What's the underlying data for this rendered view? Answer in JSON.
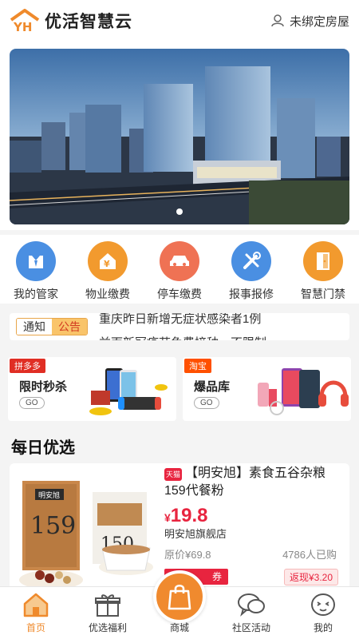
{
  "header": {
    "logo_text": "优活智慧云",
    "bind_status": "未绑定房屋"
  },
  "banner": {
    "slide_count": 1,
    "active_slide": 1
  },
  "services": [
    {
      "label": "我的管家",
      "icon": "butler-icon",
      "color": "#4a8fe2"
    },
    {
      "label": "物业缴费",
      "icon": "property-fee-icon",
      "color": "#f29a2e"
    },
    {
      "label": "停车缴费",
      "icon": "car-icon",
      "color": "#ef7254"
    },
    {
      "label": "报事报修",
      "icon": "repair-tools-icon",
      "color": "#4a8fe2"
    },
    {
      "label": "智慧门禁",
      "icon": "door-icon",
      "color": "#f29a2e"
    }
  ],
  "notice": {
    "tag_left": "通知",
    "tag_right": "公告",
    "line1": "重庆昨日新增无症状感染者1例",
    "line2": "益面新冠疫苗免费接种，不限制"
  },
  "promos": [
    {
      "badge": "拼多多",
      "title": "限时秒杀",
      "go": "GO",
      "badge_color": "#e02e24"
    },
    {
      "badge": "淘宝",
      "title": "爆品库",
      "go": "GO",
      "badge_color": "#ff5000"
    }
  ],
  "daily": {
    "title": "每日优选",
    "product": {
      "shop_badge": "天猫",
      "name": "【明安旭】素食五谷杂粮159代餐粉",
      "currency": "¥",
      "price": "19.8",
      "store": "明安旭旗舰店",
      "original_price": "原价¥69.8",
      "sold": "4786人已购",
      "coupon": "券",
      "cashback": "返现¥3.20",
      "package_label": "159",
      "package_brand": "明安旭"
    }
  },
  "tabbar": [
    {
      "label": "首页",
      "icon": "home-icon",
      "active": true
    },
    {
      "label": "优选福利",
      "icon": "gift-icon",
      "active": false
    },
    {
      "label": "商城",
      "icon": "shopping-bag-icon",
      "active": false
    },
    {
      "label": "社区活动",
      "icon": "chat-bubbles-icon",
      "active": false
    },
    {
      "label": "我的",
      "icon": "profile-face-icon",
      "active": false
    }
  ],
  "colors": {
    "accent": "#ef8a2c",
    "price": "#e8243f"
  }
}
